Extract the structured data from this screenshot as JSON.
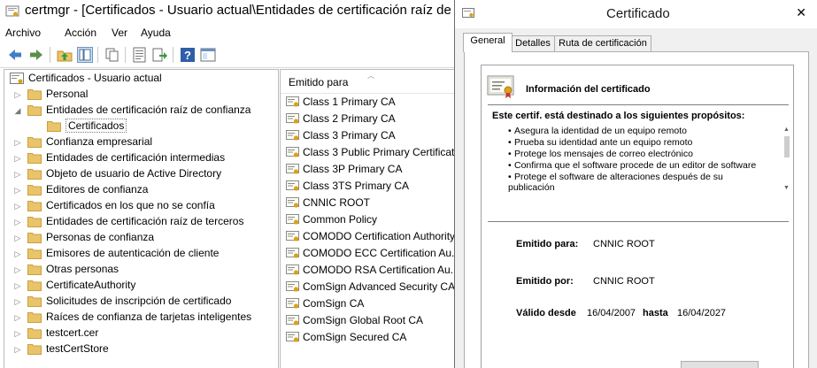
{
  "mmc": {
    "title": "certmgr - [Certificados - Usuario actual\\Entidades de certificación raíz de confianza\\Certificados]",
    "menu": [
      "Archivo",
      "Acción",
      "Ver",
      "Ayuda"
    ],
    "toolbar_icons": [
      "back-icon",
      "forward-icon",
      "up-folder-icon",
      "show-hide-tree-icon",
      "copy-icon",
      "properties-icon",
      "export-icon",
      "help-icon",
      "view-icon"
    ],
    "tree": {
      "root": "Certificados - Usuario actual",
      "items": [
        {
          "label": "Personal",
          "expanded": false,
          "indent": 1
        },
        {
          "label": "Entidades de certificación raíz de confianza",
          "expanded": true,
          "indent": 1
        },
        {
          "label": "Certificados",
          "expanded": false,
          "indent": 2,
          "selected": true
        },
        {
          "label": "Confianza empresarial",
          "expanded": false,
          "indent": 1
        },
        {
          "label": "Entidades de certificación intermedias",
          "expanded": false,
          "indent": 1
        },
        {
          "label": "Objeto de usuario de Active Directory",
          "expanded": false,
          "indent": 1
        },
        {
          "label": "Editores de confianza",
          "expanded": false,
          "indent": 1
        },
        {
          "label": "Certificados en los que no se confía",
          "expanded": false,
          "indent": 1
        },
        {
          "label": "Entidades de certificación raíz de terceros",
          "expanded": false,
          "indent": 1
        },
        {
          "label": "Personas de confianza",
          "expanded": false,
          "indent": 1
        },
        {
          "label": "Emisores de autenticación de cliente",
          "expanded": false,
          "indent": 1
        },
        {
          "label": "Otras personas",
          "expanded": false,
          "indent": 1
        },
        {
          "label": "CertificateAuthority",
          "expanded": false,
          "indent": 1
        },
        {
          "label": "Solicitudes de inscripción de certificado",
          "expanded": false,
          "indent": 1
        },
        {
          "label": "Raíces de confianza de tarjetas inteligentes",
          "expanded": false,
          "indent": 1
        },
        {
          "label": "testcert.cer",
          "expanded": false,
          "indent": 1
        },
        {
          "label": "testCertStore",
          "expanded": false,
          "indent": 1
        }
      ]
    },
    "list": {
      "column_header": "Emitido para",
      "rows": [
        "Class 1 Primary CA",
        "Class 2 Primary CA",
        "Class 3 Primary CA",
        "Class 3 Public Primary Certificat...",
        "Class 3P Primary CA",
        "Class 3TS Primary CA",
        "CNNIC ROOT",
        "Common Policy",
        "COMODO Certification Authority",
        "COMODO ECC Certification Au...",
        "COMODO RSA Certification Au...",
        "ComSign Advanced Security CA",
        "ComSign CA",
        "ComSign Global Root CA",
        "ComSign Secured CA"
      ],
      "selected_index": 6
    }
  },
  "dialog": {
    "title": "Certificado",
    "close_glyph": "✕",
    "tabs": [
      "General",
      "Detalles",
      "Ruta de certificación"
    ],
    "active_tab": 0,
    "info_title": "Información del certificado",
    "purposes_heading": "Este certif. está destinado a los siguientes propósitos:",
    "purposes": [
      "Asegura la identidad de un equipo remoto",
      "Prueba su identidad ante un equipo remoto",
      "Protege los mensajes de correo electrónico",
      "Confirma que el software procede de un editor de software",
      "Protege el software de alteraciones después de su publicación"
    ],
    "issued_to_label": "Emitido para:",
    "issued_to_value": "CNNIC ROOT",
    "issued_by_label": "Emitido por:",
    "issued_by_value": "CNNIC ROOT",
    "valid_from_label": "Válido desde",
    "valid_from_value": "16/04/2007",
    "valid_to_label": "hasta",
    "valid_to_value": "16/04/2027"
  },
  "colors": {
    "folder": "#e9c46a",
    "folder_dark": "#c9a13d",
    "accent_blue": "#2b6cb0",
    "selection_border": "#7da2ce"
  }
}
